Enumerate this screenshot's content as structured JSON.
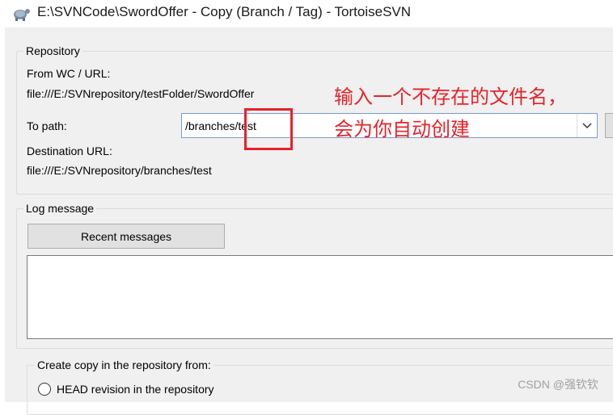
{
  "window": {
    "title": "E:\\SVNCode\\SwordOffer - Copy (Branch / Tag) - TortoiseSVN",
    "icon": "tortoisesvn-turtle-icon"
  },
  "repository": {
    "group_label": "Repository",
    "from_label": "From WC / URL:",
    "from_url": "file:///E:/SVNrepository/testFolder/SwordOffer",
    "to_path_label": "To path:",
    "to_path_value": "/branches/test",
    "dest_label": "Destination URL:",
    "dest_url": "file:///E:/SVNrepository/branches/test"
  },
  "annotation": {
    "line1": "输入一个不存在的文件名，",
    "line2": "会为你自动创建",
    "color": "#e8222a"
  },
  "log": {
    "group_label": "Log message",
    "recent_button": "Recent messages",
    "message": ""
  },
  "copy_from": {
    "group_label": "Create copy in the repository from:",
    "head_option": "HEAD revision in the repository"
  },
  "watermark": "CSDN @强钦钦"
}
